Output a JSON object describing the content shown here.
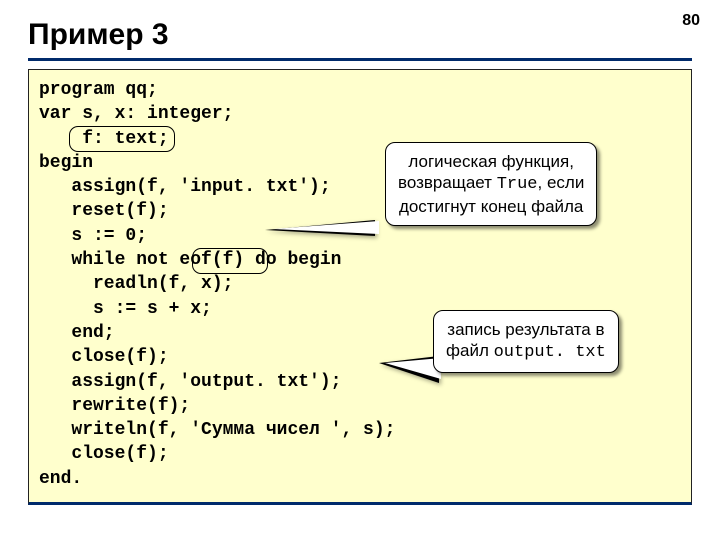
{
  "page_number": "80",
  "title": "Пример 3",
  "code": "program qq;\nvar s, x: integer;\n    f: text;\nbegin\n   assign(f, 'input. txt');\n   reset(f);\n   s := 0;\n   while not eof(f) do begin\n     readln(f, x);\n     s := s + x;\n   end;\n   close(f);\n   assign(f, 'output. txt');\n   rewrite(f);\n   writeln(f, 'Сумма чисел ', s);\n   close(f);\nend.",
  "highlight1_label": "f: text;",
  "highlight2_label": "eof(f)",
  "callout1": {
    "line1": "логическая функция,",
    "line2_pre": "возвращает ",
    "line2_mono": "True",
    "line2_post": ", если",
    "line3": "достигнут конец файла"
  },
  "callout2": {
    "line1": "запись результата в",
    "line2_pre": "файл ",
    "line2_mono": "output. txt"
  }
}
